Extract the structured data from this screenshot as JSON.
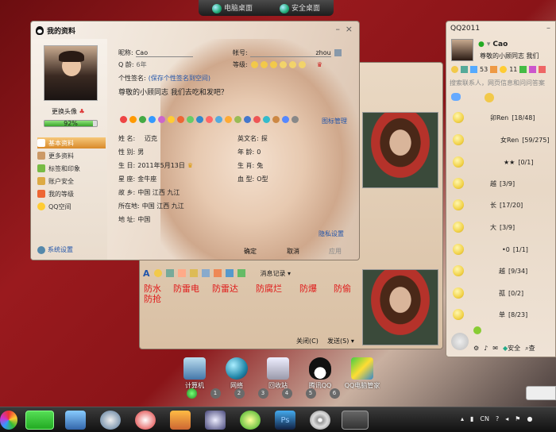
{
  "top_switch": {
    "left": "电脑桌面",
    "right": "安全桌面"
  },
  "profile": {
    "title": "我的资料",
    "nickname_label": "昵称:",
    "nickname": "Cao",
    "account_label": "帐号:",
    "account": "zhou",
    "age_label": "Q 龄:",
    "age": "6年",
    "level_label": "等级:",
    "signature_label": "个性签名:",
    "signature_link": "(保存个性签名到空间)",
    "signature": "尊敬的小顾同志   我们去吃和发吧？",
    "change_avatar": "更换头像",
    "progress": "92%",
    "progress_value": 0.92,
    "nav": [
      "基本资料",
      "更多资料",
      "标签和印象",
      "账户安全",
      "我的等级",
      "QQ空间"
    ],
    "system_settings": "系统设置",
    "icon_manage": "图标管理",
    "fields": [
      {
        "label": "姓    名:",
        "value": "迈克",
        "label2": "英文名:",
        "value2": "探"
      },
      {
        "label": "性    别:",
        "value": "男",
        "label2": "年    龄:",
        "value2": "0"
      },
      {
        "label": "生    日:",
        "value": "2011年5月13日",
        "label2": "生    肖:",
        "value2": "兔"
      },
      {
        "label": "星    座:",
        "value": "金牛座",
        "label2": "血    型:",
        "value2": "O型"
      },
      {
        "label": "故    乡:",
        "value": "中国  江西  九江",
        "label2": "",
        "value2": ""
      },
      {
        "label": "所在地:",
        "value": "中国  江西  九江",
        "label2": "",
        "value2": ""
      },
      {
        "label": "地    址:",
        "value": "中国",
        "label2": "",
        "value2": ""
      }
    ],
    "privacy": "隐私设置",
    "ok": "确定",
    "cancel": "取消",
    "apply": "应用"
  },
  "chat": {
    "msg_record": "消息记录",
    "protect": [
      "防水",
      "防雷电",
      "防雷达",
      "防腐烂",
      "防爆",
      "防偷",
      "防抢"
    ],
    "close": "关闭(C)",
    "send": "发送(S)"
  },
  "qq": {
    "title": "QQ2011",
    "name": "Cao",
    "signature": "尊敬的小顾同志  我们",
    "msg_count": "53",
    "mail_count": "11",
    "search_placeholder": "搜索联系人，网页信息和问问答案",
    "groups": [
      {
        "name": "卯Ren",
        "count": "[18/48]"
      },
      {
        "name": "女Ren",
        "count": "[59/275]"
      },
      {
        "name": "★★",
        "count": "[0/1]"
      },
      {
        "name": "越",
        "count": "[3/9]"
      },
      {
        "name": "长",
        "count": "[17/20]"
      },
      {
        "name": "大",
        "count": "[3/9]"
      },
      {
        "name": "•0",
        "count": "[1/1]"
      },
      {
        "name": "越",
        "count": "[9/34]"
      },
      {
        "name": "孤",
        "count": "[0/2]"
      },
      {
        "name": "单",
        "count": "[8/23]"
      }
    ],
    "safe": "安全",
    "search_btn": "查"
  },
  "desktop_icons": [
    "计算机",
    "网络",
    "回收站",
    "腾讯QQ",
    "QQ电脑管家"
  ],
  "pages": [
    "1",
    "2",
    "3",
    "4",
    "5",
    "6"
  ],
  "tray": {
    "lang": "CN"
  }
}
